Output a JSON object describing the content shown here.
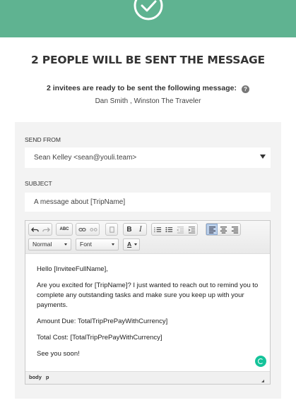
{
  "header": {
    "check_icon": "check-circle-icon",
    "title": "2 PEOPLE WILL BE SENT THE MESSAGE",
    "subtitle": "2 invitees are ready to be sent the following message:",
    "help_icon": "?",
    "recipients": "Dan Smith , Winston The Traveler"
  },
  "form": {
    "send_from_label": "SEND FROM",
    "send_from_value": "Sean Kelley <sean@youli.team>",
    "subject_label": "SUBJECT",
    "subject_value": "A message about [TripName]"
  },
  "editor": {
    "format_select": "Normal",
    "font_select": "Font",
    "text_color_label": "A",
    "body": [
      "Hello [InviteeFullName],",
      "Are you excited for [TripName]? I just wanted to reach out to remind you to complete any outstanding tasks and make sure you keep up with your payments.",
      "Amount Due: TotalTripPrePayWithCurrency]",
      "Total Cost: [TotalTripPrePayWithCurrency]",
      "See you soon!"
    ],
    "path": [
      "body",
      "p"
    ]
  },
  "colors": {
    "hero": "#5fb391",
    "panel": "#f3f3f3",
    "grammarly": "#15c39a"
  }
}
